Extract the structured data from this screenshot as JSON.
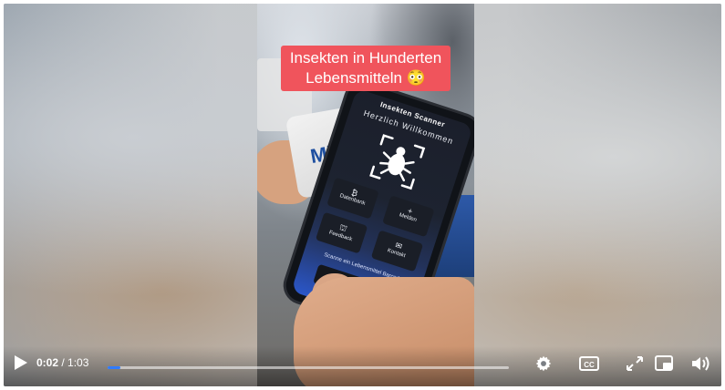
{
  "video": {
    "caption_line1": "Insekten in Hunderten",
    "caption_line2": "Lebensmitteln 😳",
    "package_text": "Mi",
    "phone_app": {
      "title": "Insekten Scanner",
      "welcome": "Herzlich Willkommen",
      "tiles": [
        {
          "glyph": "₿",
          "label": "Datenbank"
        },
        {
          "glyph": "+",
          "label": "Melden"
        },
        {
          "glyph": "⛫",
          "label": "Feedback"
        },
        {
          "glyph": "✉",
          "label": "Kontakt"
        }
      ],
      "scan_hint": "Scanne ein Lebensmittel Barcode"
    }
  },
  "controls": {
    "current_time": "0:02",
    "separator": " / ",
    "duration": "1:03",
    "progress_fraction": 0.032,
    "icons": [
      "play-icon",
      "gear-icon",
      "closed-captions-icon",
      "fullscreen-icon",
      "picture-in-picture-icon",
      "volume-icon"
    ]
  },
  "colors": {
    "caption_bg": "#f0545c",
    "progress_fill": "#2f7bff"
  }
}
